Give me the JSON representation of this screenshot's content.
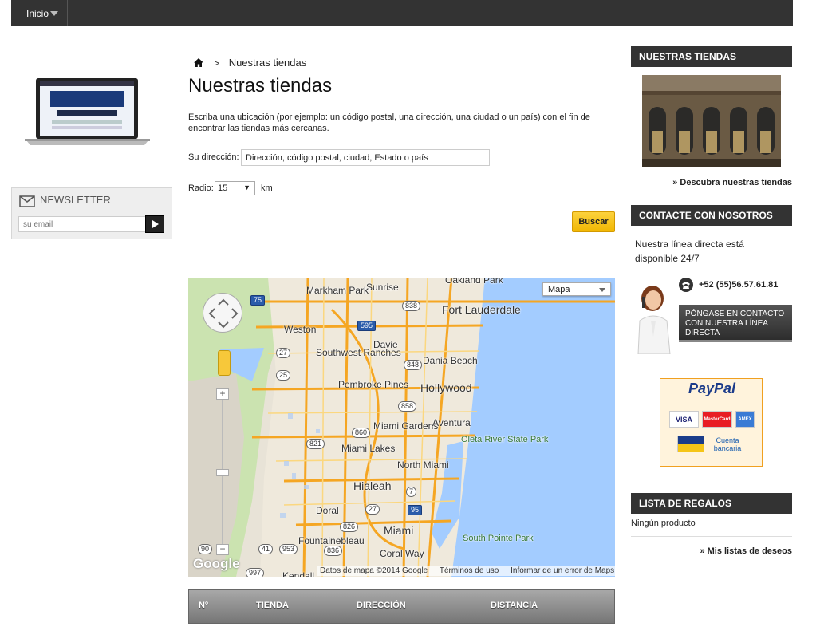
{
  "nav": {
    "home_label": "Inicio"
  },
  "newsletter": {
    "title": "NEWSLETTER",
    "placeholder": "su email"
  },
  "breadcrumb": {
    "current": "Nuestras tiendas",
    "separator": ">"
  },
  "main": {
    "title": "Nuestras tiendas",
    "intro": "Escriba una ubicación (por ejemplo: un código postal, una dirección, una ciudad o un país) con el fin de encontrar las tiendas más cercanas.",
    "address_label": "Su dirección:",
    "address_value": "Dirección, código postal, ciudad, Estado o país",
    "radius_label": "Radio:",
    "radius_value": "15",
    "radius_unit": "km",
    "search_button": "Buscar"
  },
  "map": {
    "type_selector": "Mapa",
    "logo": "Google",
    "footer": [
      "Datos de mapa ©2014 Google",
      "Términos de uso",
      "Informar de un error de Maps"
    ],
    "places": [
      "Sunrise",
      "Oakland Park",
      "Markham Park",
      "Fort Lauderdale",
      "Weston",
      "Davie",
      "Southwest Ranches",
      "Dania Beach",
      "Hollywood",
      "Pembroke Pines",
      "Miami Gardens",
      "Aventura",
      "Oleta River State Park",
      "North Miami",
      "Miami Lakes",
      "Hialeah",
      "Doral",
      "Miami",
      "Fountainebleau",
      "Coral Way",
      "South Pointe Park",
      "Kendall"
    ],
    "shields": [
      "75",
      "838",
      "595",
      "27",
      "25",
      "848",
      "858",
      "860",
      "821",
      "7",
      "27",
      "95",
      "826",
      "90",
      "41",
      "953",
      "997",
      "836"
    ]
  },
  "table": {
    "columns": [
      "Nº",
      "TIENDA",
      "DIRECCIÓN",
      "DISTANCIA"
    ]
  },
  "sidebar": {
    "stores_title": "NUESTRAS TIENDAS",
    "stores_link": "» Descubra nuestras tiendas",
    "contact_title": "CONTACTE CON NOSOTROS",
    "contact_text": "Nuestra línea directa está disponible 24/7",
    "phone": "+52 (55)56.57.61.81",
    "contact_button": "PÓNGASE EN CONTACTO CON NUESTRA LÍNEA DIRECTA",
    "paypal": {
      "logo": "PayPal",
      "cards": [
        "VISA",
        "MasterCard",
        "AMEX"
      ],
      "bank_label": "Cuenta bancaria"
    },
    "gifts_title": "LISTA DE REGALOS",
    "gifts_empty": "Ningún producto",
    "gifts_link": "» Mis listas de deseos"
  },
  "colors": {
    "topbar": "#333333",
    "button_yellow": "#f5c518",
    "map_water": "#a3ccff",
    "map_land": "#e8e3d7",
    "highway": "#f5a623"
  }
}
